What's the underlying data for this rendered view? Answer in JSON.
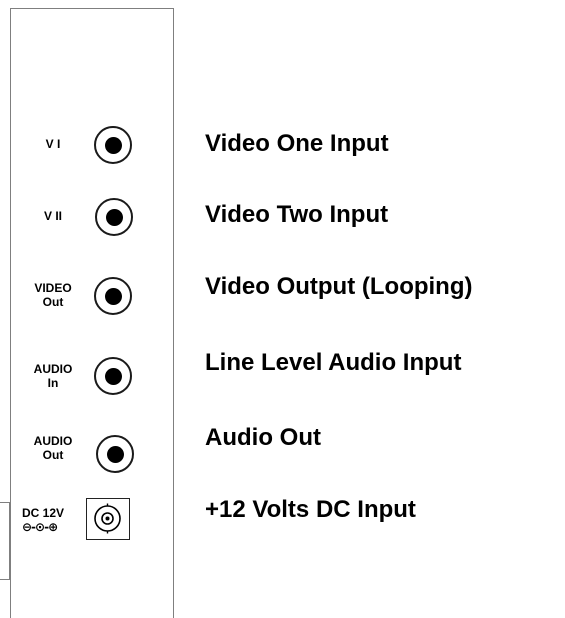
{
  "ports": [
    {
      "label_line1": "V I",
      "label_line2": "",
      "description": "Video One Input"
    },
    {
      "label_line1": "V II",
      "label_line2": "",
      "description": "Video Two Input"
    },
    {
      "label_line1": "VIDEO",
      "label_line2": "Out",
      "description": "Video Output (Looping)"
    },
    {
      "label_line1": "AUDIO",
      "label_line2": "In",
      "description": "Line Level Audio Input"
    },
    {
      "label_line1": "AUDIO",
      "label_line2": "Out",
      "description": "Audio Out"
    }
  ],
  "dc_input": {
    "label_line1": "DC 12V",
    "label_line2": "⊖-⊙-⊕",
    "description": "+12 Volts DC Input"
  },
  "colors": {
    "ink": "#000000",
    "panel_border": "#7f7f7f"
  }
}
